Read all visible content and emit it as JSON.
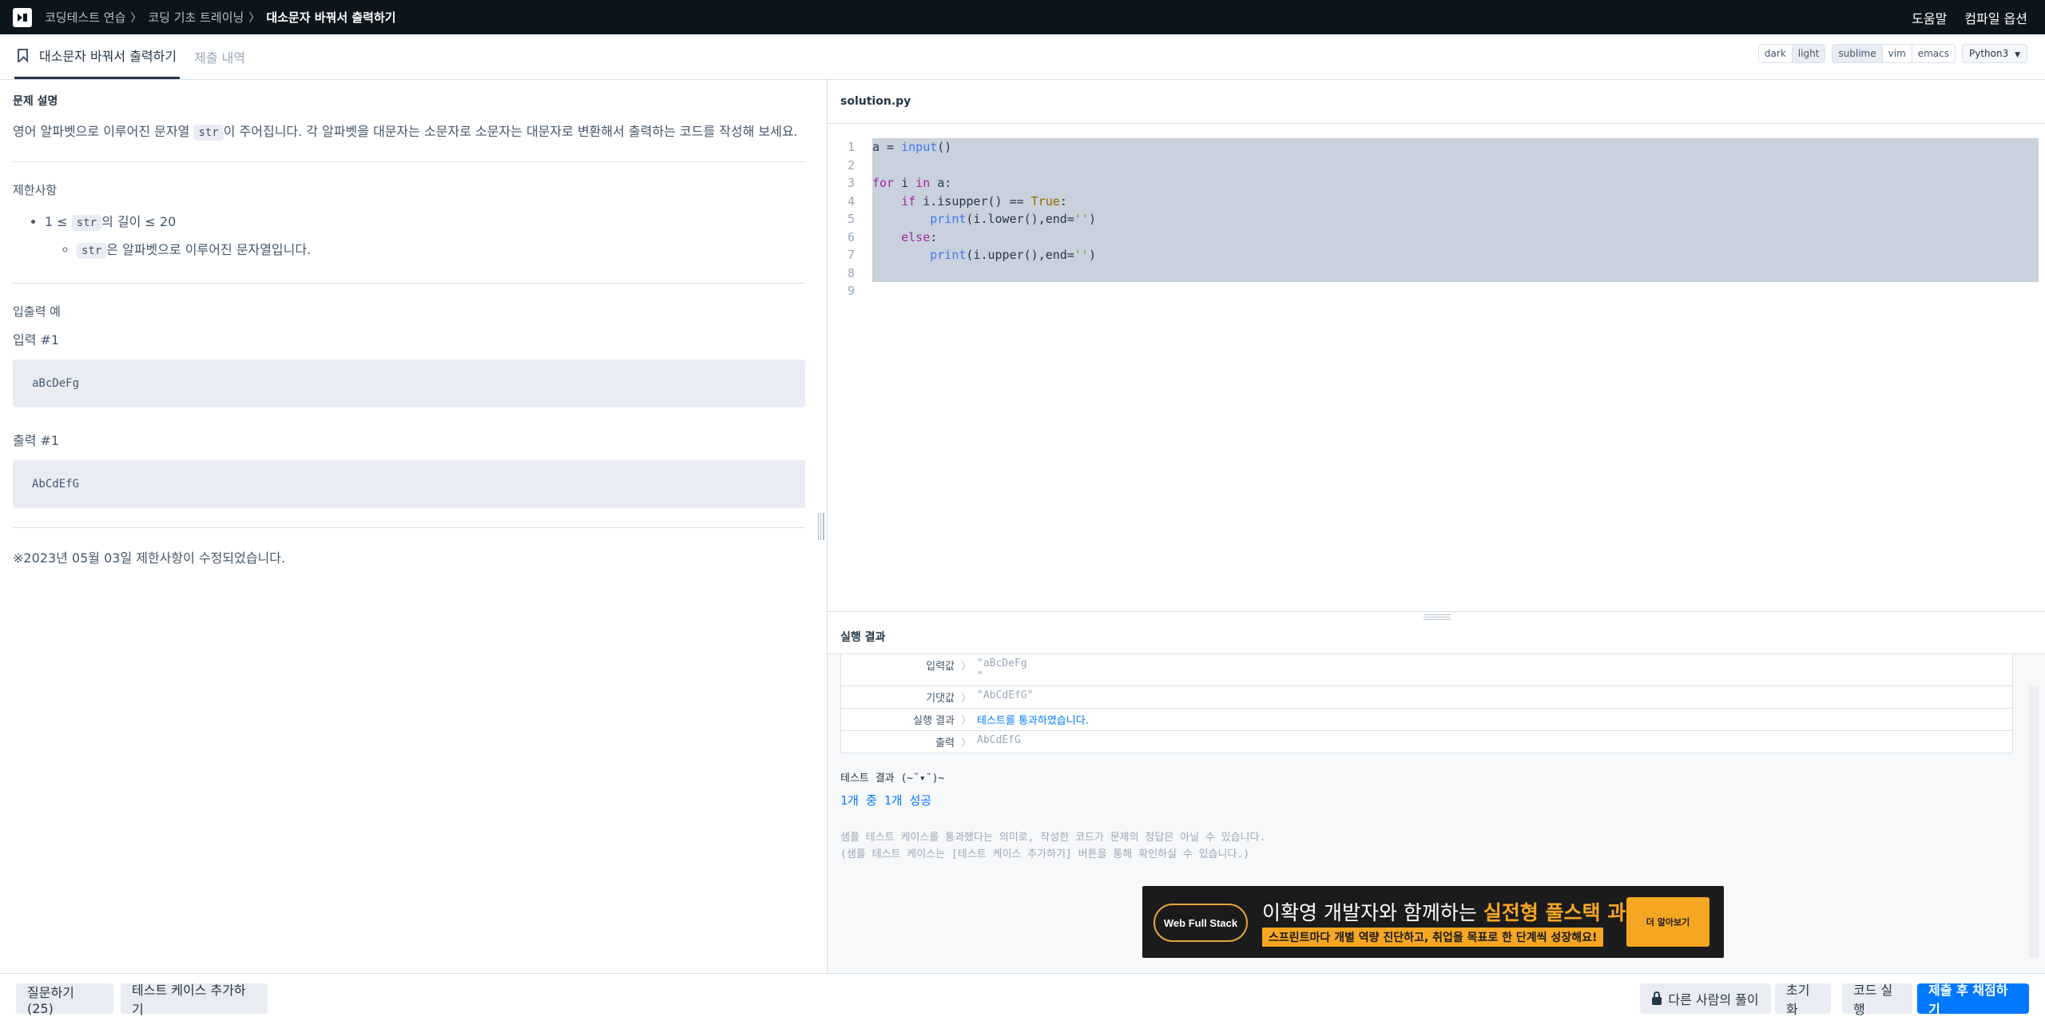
{
  "topbar": {
    "breadcrumbs": [
      "코딩테스트 연습",
      "코딩 기초 트레이닝",
      "대소문자 바꿔서 출력하기"
    ],
    "separator": "〉",
    "help": "도움말",
    "compile_options": "컴파일 옵션"
  },
  "tabs": {
    "problem": "대소문자 바꿔서 출력하기",
    "submissions": "제출 내역"
  },
  "editor_options": {
    "themes": [
      "dark",
      "light"
    ],
    "active_theme": "light",
    "keymaps": [
      "sublime",
      "vim",
      "emacs"
    ],
    "active_keymap": "sublime",
    "language": "Python3"
  },
  "problem": {
    "desc_title": "문제 설명",
    "desc_pre": "영어 알파벳으로 이루어진 문자열 ",
    "desc_code": "str",
    "desc_post": "이 주어집니다. 각 알파벳을 대문자는 소문자로 소문자는 대문자로 변환해서 출력하는 코드를 작성해 보세요.",
    "constraints_title": "제한사항",
    "c1_pre": "1 ≤ ",
    "c1_code": "str",
    "c1_post": "의 길이 ≤ 20",
    "c2_code": "str",
    "c2_post": "은 알파벳으로 이루어진 문자열입니다.",
    "io_title": "입출력 예",
    "input_label": "입력 #1",
    "input_value": "aBcDeFg",
    "output_label": "출력 #1",
    "output_value": "AbCdEfG",
    "note": "※2023년 05월 03일 제한사항이 수정되었습니다."
  },
  "editor": {
    "filename": "solution.py",
    "line_numbers": [
      "1",
      "2",
      "3",
      "4",
      "5",
      "6",
      "7",
      "8",
      "9"
    ]
  },
  "results": {
    "title": "실행 결과",
    "rows": [
      {
        "label": "입력값",
        "value": "\"aBcDeFg\n\""
      },
      {
        "label": "기댓값",
        "value": "\"AbCdEfG\""
      },
      {
        "label": "실행 결과",
        "value": "테스트를 통과하였습니다."
      },
      {
        "label": "출력",
        "value": "AbCdEfG"
      }
    ],
    "separator": "〉",
    "test_title": "테스트 결과 (~˘▾˘)~",
    "test_count": "1개 중 1개 성공",
    "note1": "샘플 테스트 케이스를 통과했다는 의미로, 작성한 코드가 문제의 정답은 아닐 수 있습니다.",
    "note2": "(샘플 테스트 케이스는 [테스트 케이스 추가하기] 버튼을 통해 확인하실 수 있습니다.)"
  },
  "ad": {
    "logo": "Web Full Stack",
    "headline_pre": "이확영 개발자와 함께하는 ",
    "headline_bold": "실전형 풀스택 과정",
    "sub": "스프린트마다 개별 역량 진단하고, 취업을 목표로 한 단계씩 성장해요!",
    "cta": "더 알아보기"
  },
  "bottom": {
    "question": "질문하기 (25)",
    "add_testcase": "테스트 케이스 추가하기",
    "others_solution": "다른 사람의 풀이",
    "reset": "초기화",
    "run": "코드 실행",
    "submit": "제출 후 채점하기"
  },
  "colors": {
    "topbar_bg": "#0c151c",
    "primary": "#0078ff",
    "selection": "#c9d1dc",
    "ad_accent": "#f5a623"
  }
}
